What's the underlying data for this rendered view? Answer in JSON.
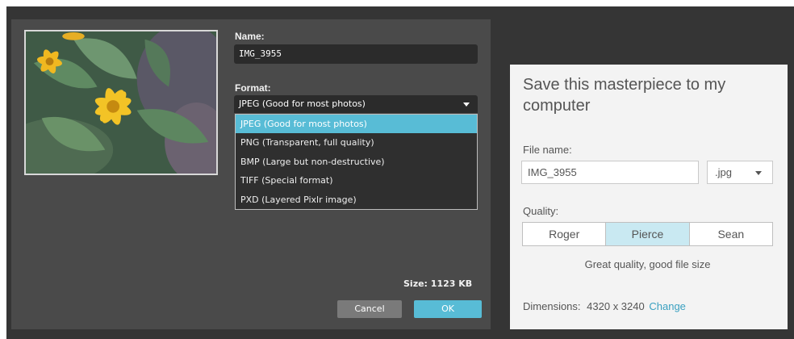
{
  "export_dialog": {
    "name_label": "Name:",
    "name_value": "IMG_3955",
    "format_label": "Format:",
    "format_selected": "JPEG (Good for most photos)",
    "format_options": [
      "JPEG (Good for most photos)",
      "PNG (Transparent, full quality)",
      "BMP (Large but non-destructive)",
      "TIFF (Special format)",
      "PXD (Layered Pixlr image)"
    ],
    "size_text": "Size: 1123 KB",
    "cancel_label": "Cancel",
    "ok_label": "OK",
    "accent_color": "#58bcd6"
  },
  "save_dialog": {
    "title": "Save this masterpiece to my computer",
    "file_name_label": "File name:",
    "file_name_value": "IMG_3955",
    "extension_value": ".jpg",
    "quality_label": "Quality:",
    "quality_options": [
      "Roger",
      "Pierce",
      "Sean"
    ],
    "quality_selected": "Pierce",
    "quality_description": "Great quality, good file size",
    "dimensions_label": "Dimensions:",
    "dimensions_value": "4320 x 3240",
    "change_link": "Change",
    "link_color": "#3aa0c0"
  }
}
